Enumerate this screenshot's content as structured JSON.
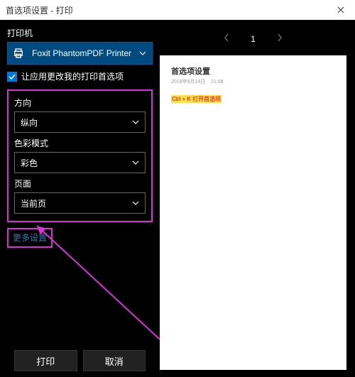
{
  "titlebar": {
    "title": "首选项设置 - 打印"
  },
  "left": {
    "printer_label": "打印机",
    "printer_name": "Foxit PhantomPDF Printer",
    "allow_app_label": "让应用更改我的打印首选项",
    "orientation_label": "方向",
    "orientation_value": "纵向",
    "color_label": "色彩模式",
    "color_value": "彩色",
    "pages_label": "页面",
    "pages_value": "当前页",
    "more_link": "更多设置",
    "print_btn": "打印",
    "cancel_btn": "取消"
  },
  "pager": {
    "current": "1"
  },
  "preview": {
    "title": "首选项设置",
    "meta_date": "2018年6月14日",
    "meta_time": "21:08",
    "body_text": "Ctrl + K 打开首选项"
  }
}
